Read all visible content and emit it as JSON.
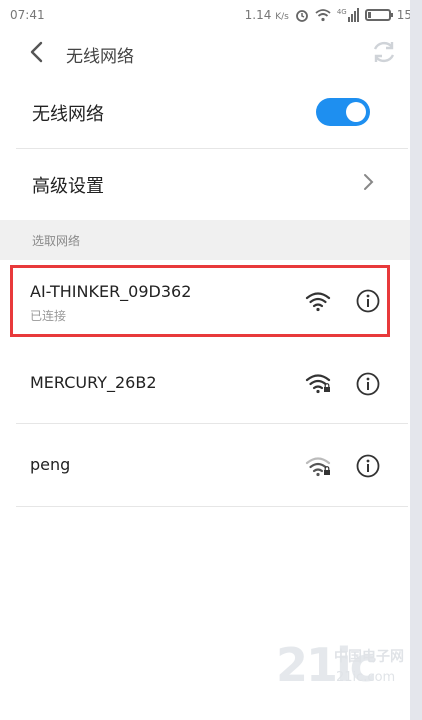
{
  "status_bar": {
    "time": "07:41",
    "speed": "1.14",
    "speed_unit": "K/s",
    "network_type": "4G",
    "battery": "15"
  },
  "header": {
    "title": "无线网络"
  },
  "settings": {
    "wifi_label": "无线网络",
    "wifi_enabled": true,
    "advanced_label": "高级设置"
  },
  "section": {
    "choose_network": "选取网络"
  },
  "networks": [
    {
      "ssid": "AI-THINKER_09D362",
      "status": "已连接",
      "secured": false,
      "signal": "strong"
    },
    {
      "ssid": "MERCURY_26B2",
      "status": "",
      "secured": true,
      "signal": "strong"
    },
    {
      "ssid": "peng",
      "status": "",
      "secured": true,
      "signal": "weak"
    }
  ],
  "watermark": {
    "brand": "21ic",
    "site_name": "中国电子网",
    "url": "21ic.com"
  },
  "colors": {
    "accent": "#1e8ff0",
    "highlight": "#e8393b"
  }
}
